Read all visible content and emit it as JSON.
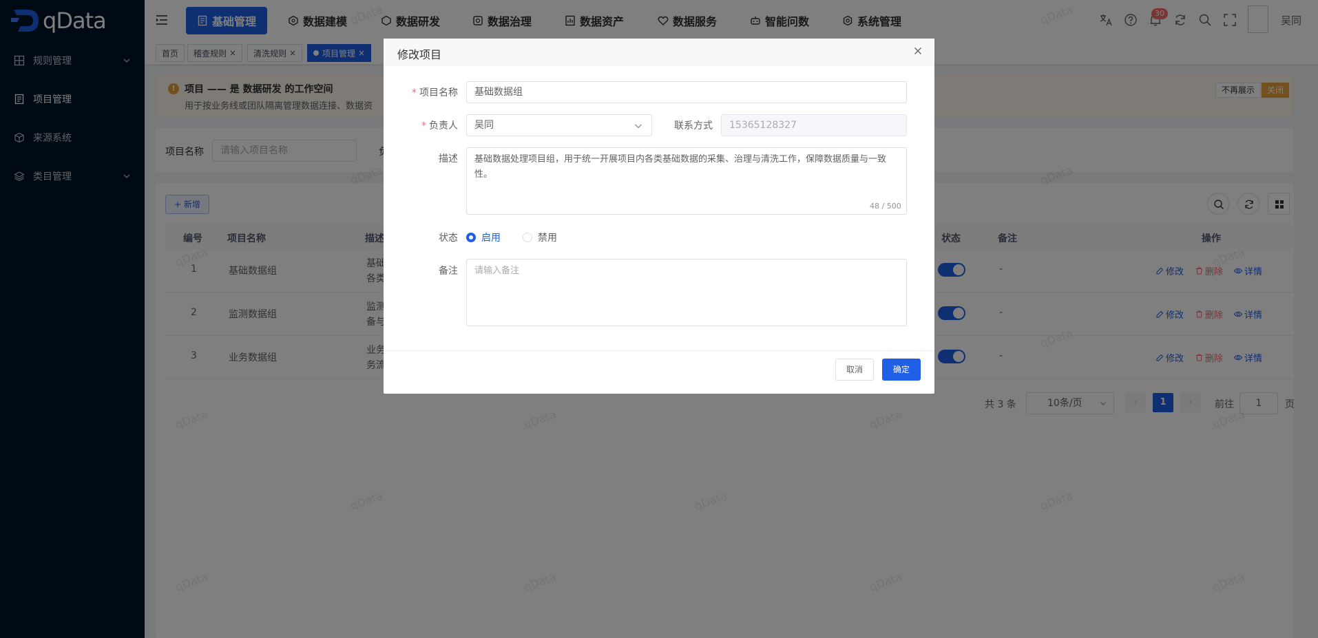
{
  "app": {
    "logo_text": "qData"
  },
  "sidebar": {
    "items": [
      {
        "label": "规则管理",
        "icon": "grid-icon",
        "has_children": true
      },
      {
        "label": "项目管理",
        "icon": "document-icon",
        "active": true
      },
      {
        "label": "来源系统",
        "icon": "cube-icon"
      },
      {
        "label": "类目管理",
        "icon": "layers-icon",
        "has_children": true
      }
    ]
  },
  "header": {
    "nav": [
      {
        "label": "基础管理",
        "icon": "document-icon",
        "active": true
      },
      {
        "label": "数据建模",
        "icon": "hexagon-icon"
      },
      {
        "label": "数据研发",
        "icon": "hexagon-icon"
      },
      {
        "label": "数据治理",
        "icon": "shield-icon"
      },
      {
        "label": "数据资产",
        "icon": "chart-icon"
      },
      {
        "label": "数据服务",
        "icon": "heart-icon"
      },
      {
        "label": "智能问数",
        "icon": "robot-icon"
      },
      {
        "label": "系统管理",
        "icon": "gear-icon"
      }
    ],
    "notification_count": "30",
    "username": "吴同"
  },
  "tags": [
    {
      "label": "首页"
    },
    {
      "label": "稽查规则",
      "closable": true
    },
    {
      "label": "清洗规则",
      "closable": true
    },
    {
      "label": "项目管理",
      "closable": true,
      "active": true
    }
  ],
  "alert": {
    "title": "项目 —— 是 数据研发 的工作空间",
    "desc": "用于按业务线或团队隔离管理数据连接、数据资",
    "hide_label": "不再展示",
    "close_label": "关闭"
  },
  "search": {
    "name_label": "项目名称",
    "name_placeholder": "请输入项目名称",
    "cut_label": "负"
  },
  "toolbar": {
    "add_label": "+ 新增"
  },
  "table": {
    "columns": [
      "编号",
      "项目名称",
      "描述",
      "状态",
      "备注",
      "操作"
    ],
    "rows": [
      {
        "id": "1",
        "name": "基础数据组",
        "desc_line1": "基础",
        "desc_line2": "各类",
        "status_on": true,
        "remark": "-"
      },
      {
        "id": "2",
        "name": "监测数据组",
        "desc_line1": "监测",
        "desc_line2": "备与",
        "status_on": true,
        "remark": "-"
      },
      {
        "id": "3",
        "name": "业务数据组",
        "desc_line1": "业务",
        "desc_line2": "务流",
        "status_on": true,
        "remark": "-"
      }
    ],
    "actions": {
      "edit": "修改",
      "delete": "删除",
      "view": "详情"
    }
  },
  "pagination": {
    "total": "共 3 条",
    "page_size": "10条/页",
    "prev": "‹",
    "current": "1",
    "next": "›",
    "goto_label": "前往",
    "goto_value": "1",
    "page_label": "页"
  },
  "watermark": "qData",
  "dialog": {
    "title": "修改项目",
    "fields": {
      "name_label": "项目名称",
      "name_value": "基础数据组",
      "owner_label": "负责人",
      "owner_value": "吴同",
      "contact_label": "联系方式",
      "contact_value": "15365128327",
      "desc_label": "描述",
      "desc_value": "基础数据处理项目组，用于统一开展项目内各类基础数据的采集、治理与清洗工作，保障数据质量与一致性。",
      "desc_count": "48 / 500",
      "status_label": "状态",
      "status_enabled": "启用",
      "status_disabled": "禁用",
      "remark_label": "备注",
      "remark_placeholder": "请输入备注"
    },
    "cancel_label": "取消",
    "ok_label": "确定"
  },
  "colors": {
    "primary": "#1e5fe6",
    "sidebar_bg": "#001529",
    "warning": "#e6a23c",
    "danger": "#f56c6c"
  }
}
